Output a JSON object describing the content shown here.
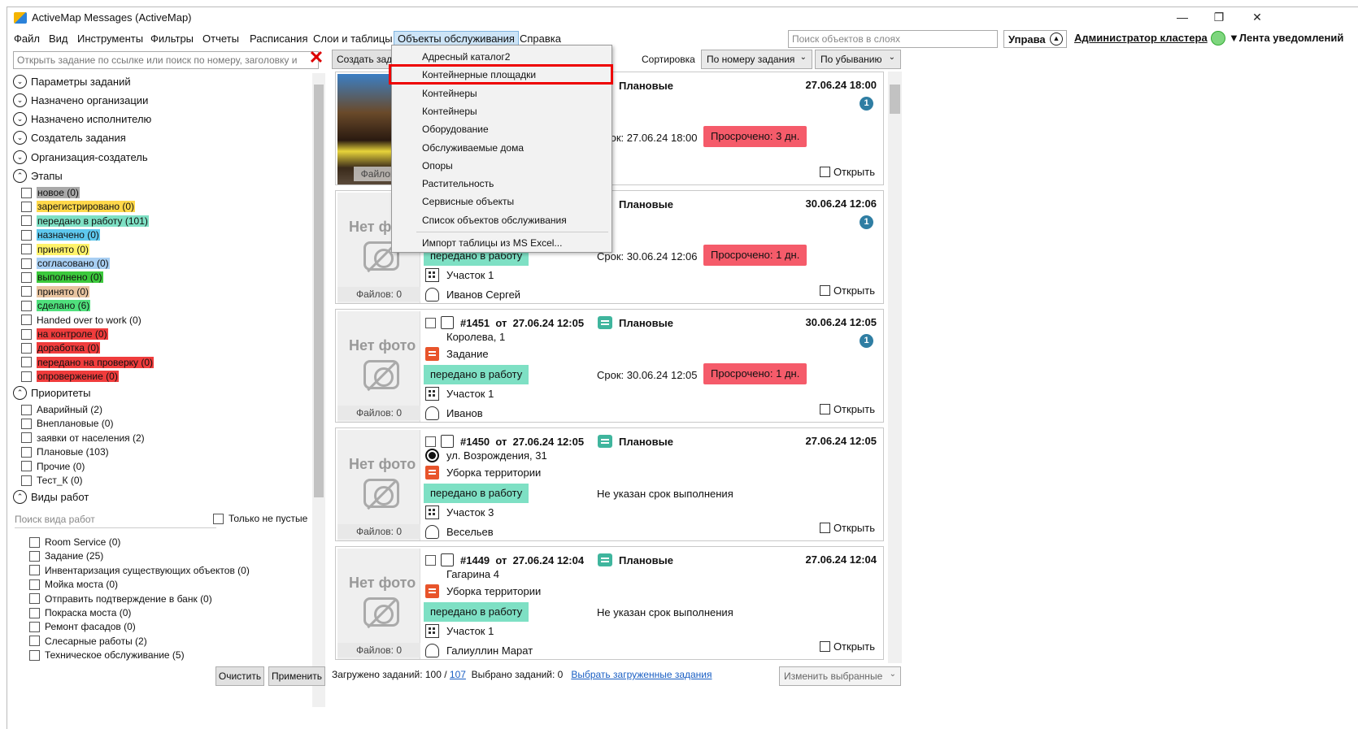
{
  "window": {
    "title": "ActiveMap Messages (ActiveMap)"
  },
  "menu": [
    "Файл",
    "Вид",
    "Инструменты",
    "Фильтры",
    "Отчеты",
    "Расписания",
    "Слои и таблицы",
    "Объекты обслуживания",
    "Справка"
  ],
  "top": {
    "layer_search_placeholder": "Поиск объектов в слоях",
    "uprava": "Управа",
    "admin": "Администратор кластера",
    "feed": "Лента уведомлений"
  },
  "left": {
    "search_placeholder": "Открыть задание по ссылке или поиск по номеру, заголовку и",
    "groups": {
      "params": "Параметры заданий",
      "assigned_org": "Назначено организации",
      "assigned_exec": "Назначено исполнителю",
      "creator": "Создатель задания",
      "creator_org": "Организация-создатель",
      "stages": "Этапы",
      "priorities": "Приоритеты",
      "work_types": "Виды работ"
    },
    "stages": [
      {
        "label": "новое (0)",
        "color": "#a9a9a9"
      },
      {
        "label": "зарегистрировано (0)",
        "color": "#ffd84a"
      },
      {
        "label": "передано в работу (101)",
        "color": "#7ee0c4"
      },
      {
        "label": "назначено (0)",
        "color": "#5ec8ee"
      },
      {
        "label": "принято (0)",
        "color": "#fff36a"
      },
      {
        "label": "согласовано (0)",
        "color": "#a8cff3"
      },
      {
        "label": "выполнено (0)",
        "color": "#3cc93c"
      },
      {
        "label": "принято (0)",
        "color": "#e8c4a0"
      },
      {
        "label": "сделано (6)",
        "color": "#4fe07c"
      },
      {
        "label": "Handed over to work (0)",
        "color": ""
      },
      {
        "label": "на контроле (0)",
        "color": "#f03c3c"
      },
      {
        "label": "доработка (0)",
        "color": "#f03c3c"
      },
      {
        "label": "передано на проверку (0)",
        "color": "#f03c3c"
      },
      {
        "label": "опровержение (0)",
        "color": "#f03c3c"
      }
    ],
    "priorities": [
      "Аварийный (2)",
      "Внеплановые (0)",
      "заявки от населения (2)",
      "Плановые (103)",
      "Прочие (0)",
      "Тест_К (0)"
    ],
    "work_search_placeholder": "Поиск вида работ",
    "only_nonempty": "Только не пустые",
    "work_types": [
      "Room Service (0)",
      "Задание (25)",
      "Инвентаризация существующих объектов (0)",
      "Мойка моста (0)",
      "Отправить подтверждение в банк (0)",
      "Покраска моста (0)",
      "Ремонт фасадов (0)",
      "Слесарные работы (2)",
      "Техническое обслуживание (5)"
    ],
    "clear_btn": "Очистить",
    "apply_btn": "Применить"
  },
  "center": {
    "create_btn": "Создать задание",
    "sort_label": "Сортировка",
    "sort_by": "По номеру задания",
    "sort_order": "По убыванию",
    "open_label": "Открыть",
    "cards": [
      {
        "id": "",
        "from": "",
        "created": "",
        "priority": "Плановые",
        "date": "27.06.24 18:00",
        "badge": "1",
        "address": "",
        "type": "",
        "status": "",
        "due": "Срок: 27.06.24 18:00",
        "overdue": "Просрочено: 3 дн.",
        "area": "",
        "person": "",
        "files": "Файлов: 0",
        "nophoto": ""
      },
      {
        "id": "",
        "from": "",
        "created": "",
        "priority": "Плановые",
        "date": "30.06.24 12:06",
        "badge": "1",
        "address": "",
        "type": "",
        "status": "передано в работу",
        "due": "Срок: 30.06.24 12:06",
        "overdue": "Просрочено: 1 дн.",
        "area": "Участок 1",
        "person": "Иванов Сергей",
        "files": "Файлов: 0",
        "nophoto": "Нет фото"
      },
      {
        "id": "#1451",
        "from": "от",
        "created": "27.06.24 12:05",
        "priority": "Плановые",
        "date": "30.06.24 12:05",
        "badge": "1",
        "address": "Королева, 1",
        "type": "Задание",
        "status": "передано в работу",
        "due": "Срок: 30.06.24 12:05",
        "overdue": "Просрочено: 1 дн.",
        "area": "Участок 1",
        "person": "Иванов",
        "files": "Файлов: 0",
        "nophoto": "Нет фото"
      },
      {
        "id": "#1450",
        "from": "от",
        "created": "27.06.24 12:05",
        "priority": "Плановые",
        "date": "27.06.24 12:05",
        "badge": "",
        "address": "ул. Возрождения, 31",
        "type": "Уборка территории",
        "status": "передано в работу",
        "due": "Не указан срок выполнения",
        "overdue": "",
        "area": "Участок 3",
        "person": "Весельев",
        "files": "Файлов: 0",
        "nophoto": "Нет фото"
      },
      {
        "id": "#1449",
        "from": "от",
        "created": "27.06.24 12:04",
        "priority": "Плановые",
        "date": "27.06.24 12:04",
        "badge": "",
        "address": "Гагарина 4",
        "type": "Уборка территории",
        "status": "передано в работу",
        "due": "Не указан срок выполнения",
        "overdue": "",
        "area": "Участок 1",
        "person": "Галиуллин Марат",
        "files": "Файлов: 0",
        "nophoto": "Нет фото"
      }
    ],
    "loaded_label": "Загружено заданий: 100 /",
    "loaded_total": "107",
    "selected_label": "Выбрано заданий: 0",
    "select_loaded": "Выбрать загруженные задания",
    "change_selected": "Изменить выбранные"
  },
  "dropdown": {
    "items": [
      "Адресный каталог2",
      "Контейнерные площадки",
      "Контейнеры",
      "Контейнеры",
      "Оборудование",
      "Обслуживаемые дома",
      "Опоры",
      "Растительность",
      "Сервисные объекты",
      "Список объектов обслуживания"
    ],
    "import": "Импорт таблицы из MS Excel..."
  }
}
